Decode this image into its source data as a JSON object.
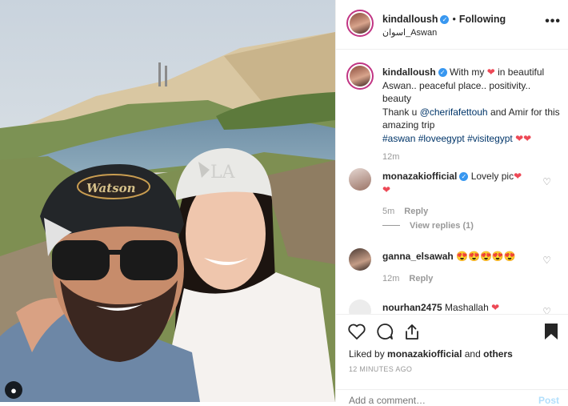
{
  "post": {
    "username": "kindalloush",
    "follow_label": "Following",
    "location": "اسوان_Aswan",
    "more_label": "•••"
  },
  "caption": {
    "username": "kindalloush",
    "line1_a": "With my",
    "line1_b": "in beautiful Aswan.. peaceful place.. positivity.. beauty",
    "line2_a": "Thank u",
    "mention": "@cherifafettouh",
    "line2_b": "and Amir for this amazing trip",
    "hashtags": "#aswan #loveegypt #visitegypt",
    "time": "12m"
  },
  "comments": [
    {
      "username": "monazakiofficial",
      "text": "Lovely pic",
      "time": "5m",
      "reply": "Reply",
      "view_replies": "View replies (1)"
    },
    {
      "username": "ganna_elsawah",
      "text": "😍😍😍😍😍",
      "time": "12m",
      "reply": "Reply"
    },
    {
      "username": "nourhan2475",
      "text": "Mashallah"
    }
  ],
  "likes": {
    "prefix": "Liked by",
    "user": "monazakiofficial",
    "and": "and",
    "others": "others"
  },
  "timestamp": "12 MINUTES AGO",
  "comment_box": {
    "placeholder": "Add a comment…",
    "post_label": "Post"
  },
  "photo": {
    "brand_cap": "Watson",
    "cap_logo": "LA"
  },
  "colors": {
    "heart": "#ed4956",
    "link": "#003569",
    "verified": "#3897f0",
    "story_ring": "#c13584"
  }
}
